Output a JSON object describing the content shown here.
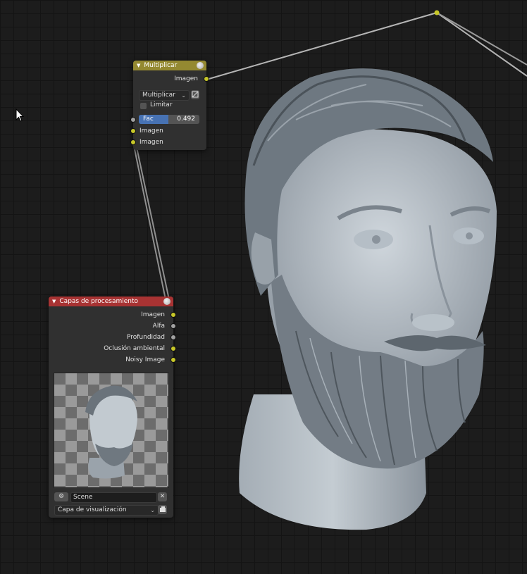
{
  "cursor": {
    "icon": "arrow-cursor-icon"
  },
  "multiply_node": {
    "title": "Multiplicar",
    "header_color": "#948931",
    "output_label": "Imagen",
    "blend_mode": "Multiplicar",
    "clamp_label": "Limitar",
    "fac_label": "Fac",
    "fac_value": "0.492",
    "fac_fraction": 0.492,
    "input1_label": "Imagen",
    "input2_label": "Imagen"
  },
  "render_layers_node": {
    "title": "Capas de procesamiento",
    "header_color": "#a83333",
    "outputs": [
      {
        "label": "Imagen",
        "socket": "yellow"
      },
      {
        "label": "Alfa",
        "socket": "gray"
      },
      {
        "label": "Profundidad",
        "socket": "gray"
      },
      {
        "label": "Oclusión ambiental",
        "socket": "yellow"
      },
      {
        "label": "Noisy Image",
        "socket": "yellow"
      }
    ],
    "scene_name": "Scene",
    "view_layer": "Capa de visualización"
  },
  "colors": {
    "socket_image": "#c7c729",
    "socket_value": "#a1a1a1",
    "link": "#b5b5b5",
    "accent": "#4772b3"
  }
}
